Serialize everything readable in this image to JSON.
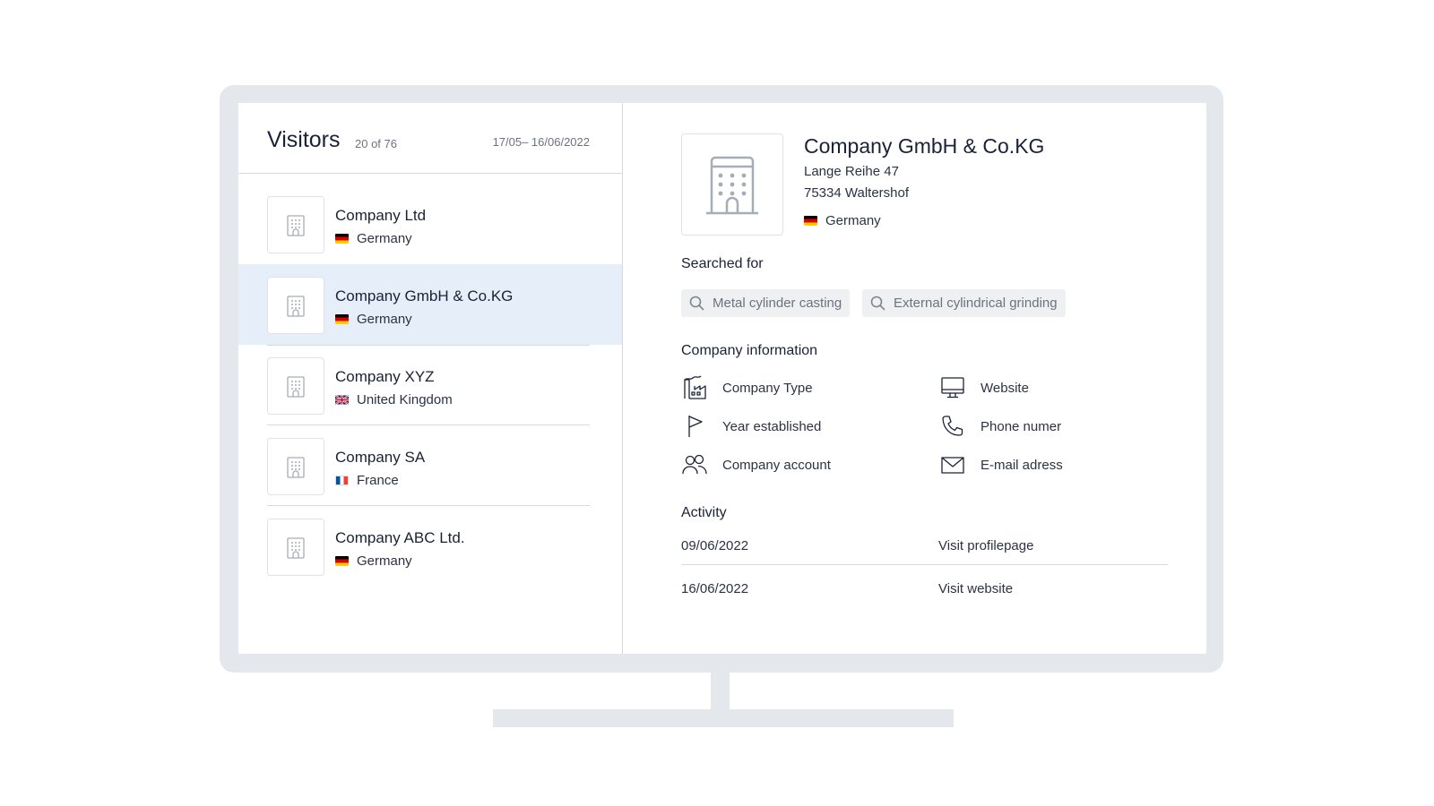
{
  "visitors": {
    "title": "Visitors",
    "count": "20 of 76",
    "date_range": "17/05– 16/06/2022",
    "items": [
      {
        "name": "Company Ltd",
        "country": "Germany",
        "flag": "de"
      },
      {
        "name": "Company GmbH & Co.KG",
        "country": "Germany",
        "flag": "de",
        "selected": true
      },
      {
        "name": "Company XYZ",
        "country": "United Kingdom",
        "flag": "uk"
      },
      {
        "name": "Company SA",
        "country": "France",
        "flag": "fr"
      },
      {
        "name": "Company ABC Ltd.",
        "country": "Germany",
        "flag": "de"
      }
    ]
  },
  "detail": {
    "name": "Company GmbH & Co.KG",
    "street": "Lange Reihe 47",
    "city": "75334 Waltershof",
    "country": "Germany",
    "searched_for_title": "Searched for",
    "searched_terms": [
      "Metal cylinder casting",
      "External cylindrical grinding"
    ],
    "company_info_title": "Company information",
    "company_info": [
      {
        "label": "Company Type",
        "icon": "factory-icon"
      },
      {
        "label": "Website",
        "icon": "monitor-icon"
      },
      {
        "label": "Year established",
        "icon": "flag-icon"
      },
      {
        "label": "Phone numer",
        "icon": "phone-icon"
      },
      {
        "label": "Company account",
        "icon": "users-icon"
      },
      {
        "label": "E-mail adress",
        "icon": "mail-icon"
      }
    ],
    "activity_title": "Activity",
    "activity": [
      {
        "date": "09/06/2022",
        "action": "Visit profilepage"
      },
      {
        "date": "16/06/2022",
        "action": "Visit website"
      }
    ]
  },
  "colors": {
    "selected_row": "#e6eef9",
    "text_dark": "#1b2236",
    "text_muted": "#6c7280",
    "frame": "#e4e7eb",
    "icon_gray": "#a7adb6"
  }
}
